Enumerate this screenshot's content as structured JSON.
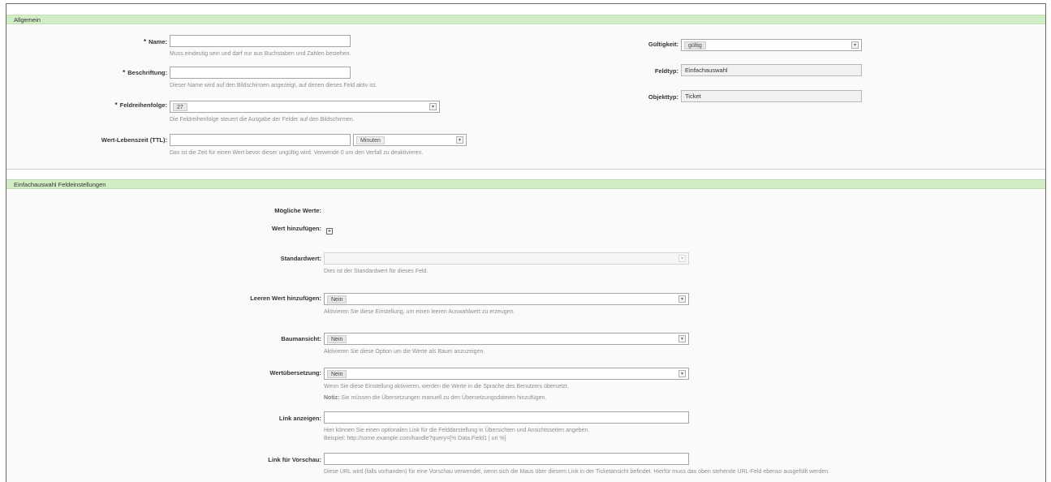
{
  "general": {
    "section_title": "Allgemein",
    "name": {
      "label": "Name:",
      "required": "*",
      "value": "",
      "hint": "Muss eindeutig sein und darf nur aus Buchstaben und Zahlen bestehen."
    },
    "label_field": {
      "label": "Beschriftung:",
      "required": "*",
      "value": "",
      "hint": "Dieser Name wird auf den Bildschirmen angezeigt, auf denen dieses Feld aktiv ist."
    },
    "field_order": {
      "label": "Feldreihenfolge:",
      "required": "*",
      "value": "27",
      "hint": "Die Feldreihenfolge steuert die Ausgabe der Felder auf den Bildschirmen."
    },
    "ttl": {
      "label": "Wert-Lebenszeit (TTL):",
      "value": "",
      "unit": "Minuten",
      "hint": "Das ist die Zeit für einen Wert bevor dieser ungültig wird. Verwende 0 um den Verfall zu deaktivieren."
    },
    "validity": {
      "label": "Gültigkeit:",
      "value": "gültig"
    },
    "field_type": {
      "label": "Feldtyp:",
      "value": "Einfachauswahl"
    },
    "object_type": {
      "label": "Objekttyp:",
      "value": "Ticket"
    }
  },
  "field_settings": {
    "section_title": "Einfachauswahl Feldeinstellungen",
    "possible_values": {
      "label": "Mögliche Werte:"
    },
    "add_value": {
      "label": "Wert hinzufügen:",
      "icon": "plus-icon"
    },
    "default_value": {
      "label": "Standardwert:",
      "value": "",
      "hint": "Dies ist der Standardwert für dieses Feld."
    },
    "add_empty": {
      "label": "Leeren Wert hinzufügen:",
      "value": "Nein",
      "hint": "Aktivieren Sie diese Einstellung, um einen leeren Auswahlwert zu erzeugen."
    },
    "tree_view": {
      "label": "Baumansicht:",
      "value": "Nein",
      "hint": "Aktivieren Sie diese Option um die Werte als Baum anzuzeigen."
    },
    "translation": {
      "label": "Wertübersetzung:",
      "value": "Nein",
      "hint": "Wenn Sie diese Einstellung aktivieren, werden die Werte in die Sprache des Benutzers übersetzt.",
      "note_label": "Notiz:",
      "note": "Sie müssen die Übersetzungen manuell zu den Übersetzungsdateien hinzufügen."
    },
    "link": {
      "label": "Link anzeigen:",
      "value": "",
      "hint": "Hier können Sie einen optionalen Link für die Felddarstellung in Übersichten und Ansichtsseiten angeben.",
      "example": "Beispiel: http://some.example.com/handle?query=[% Data.Field1 | uri %]"
    },
    "preview_link": {
      "label": "Link für Vorschau:",
      "value": "",
      "hint": "Diese URL wird (falls vorhanden) für eine Vorschau verwendet, wenn sich die Maus über diesem Link in der Ticketansicht befindet. Hierfür muss das oben stehende URL-Feld ebenso ausgefüllt werden."
    }
  },
  "colors": {
    "section_header": "#d2edc6",
    "frame_border": "#6b6b6b"
  }
}
